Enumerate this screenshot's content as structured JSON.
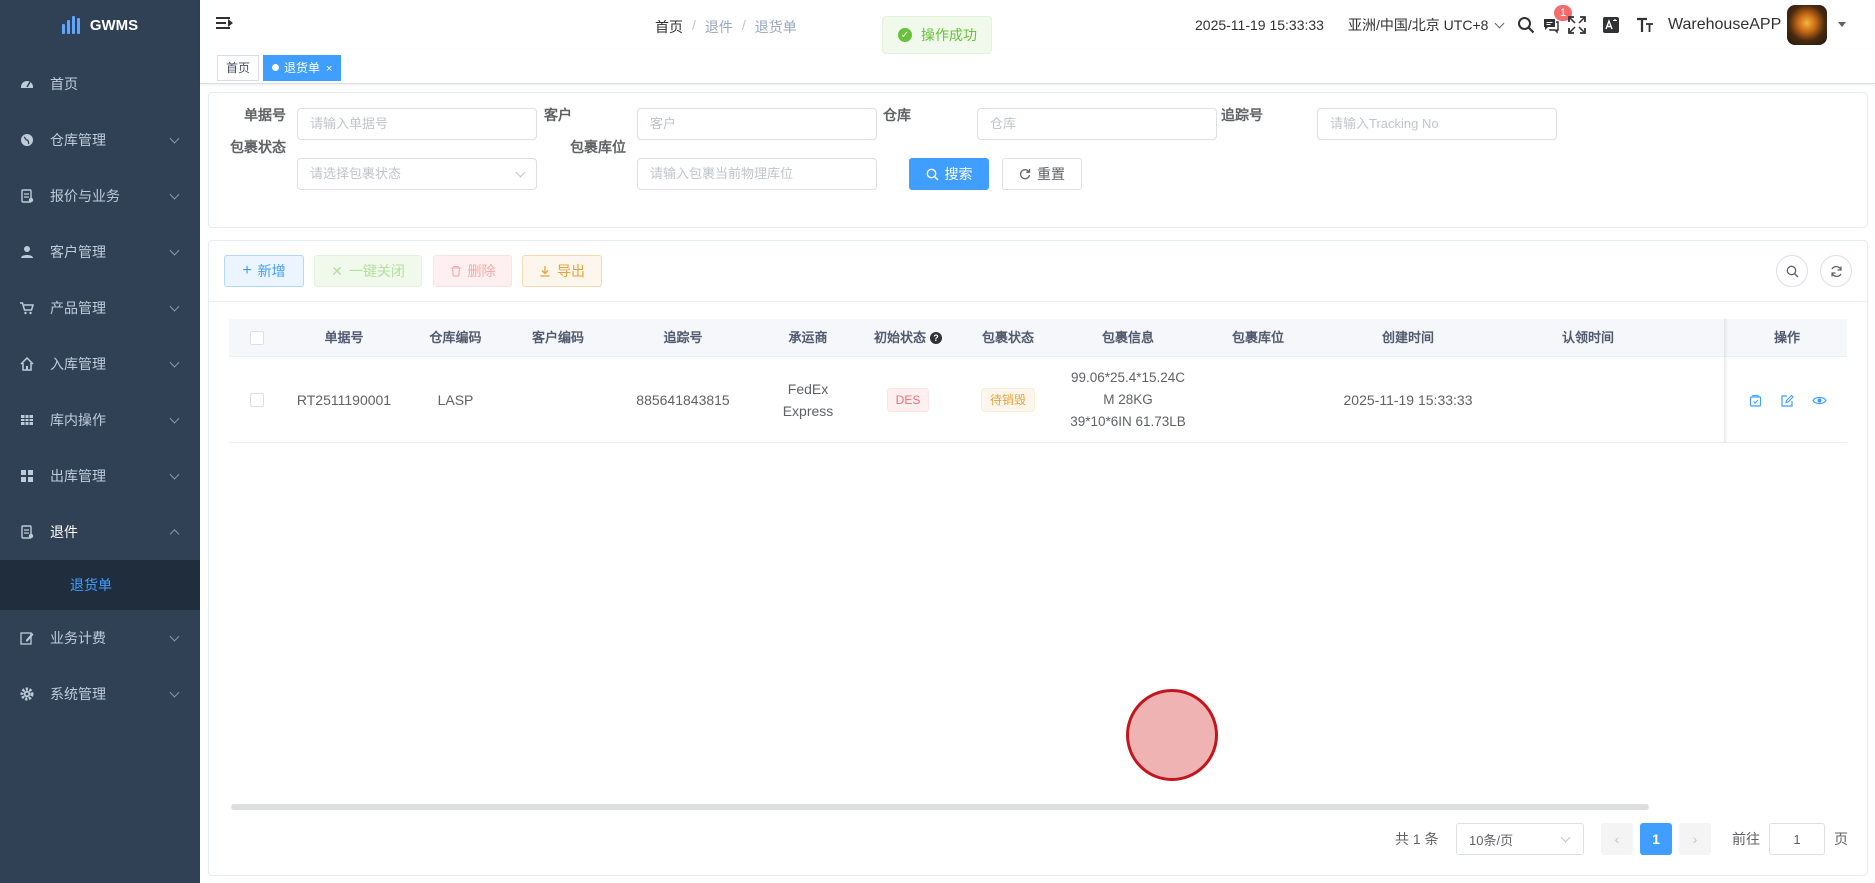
{
  "app": {
    "name": "GWMS"
  },
  "sidebar": {
    "items": [
      {
        "label": "首页",
        "icon": "dashboard-icon"
      },
      {
        "label": "仓库管理",
        "icon": "globe-icon"
      },
      {
        "label": "报价与业务",
        "icon": "quote-icon"
      },
      {
        "label": "客户管理",
        "icon": "user-icon"
      },
      {
        "label": "产品管理",
        "icon": "cart-icon"
      },
      {
        "label": "入库管理",
        "icon": "home-icon"
      },
      {
        "label": "库内操作",
        "icon": "table-icon"
      },
      {
        "label": "出库管理",
        "icon": "grid-icon"
      },
      {
        "label": "退件",
        "icon": "form-icon"
      },
      {
        "label": "业务计费",
        "icon": "edit-icon"
      },
      {
        "label": "系统管理",
        "icon": "gear-icon"
      }
    ],
    "active_sub": "退货单"
  },
  "navbar": {
    "breadcrumb": [
      "首页",
      "退件",
      "退货单"
    ],
    "toast": "操作成功",
    "datetime": "2025-11-19 15:33:33",
    "timezone": "亚洲/中国/北京 UTC+8",
    "message_count": "1",
    "username": "WarehouseAPP"
  },
  "tags": {
    "home": "首页",
    "current": "退货单"
  },
  "search": {
    "order_no_label": "单据号",
    "order_no_placeholder": "请输入单据号",
    "customer_label": "客户",
    "customer_placeholder": "客户",
    "warehouse_label": "仓库",
    "warehouse_placeholder": "仓库",
    "tracking_label": "追踪号",
    "tracking_placeholder": "请输入Tracking No",
    "pkg_status_label": "包裹状态",
    "pkg_status_placeholder": "请选择包裹状态",
    "pkg_location_label": "包裹库位",
    "pkg_location_placeholder": "请输入包裹当前物理库位",
    "search_button": "搜索",
    "reset_button": "重置"
  },
  "toolbar": {
    "add": "新增",
    "close_all": "一键关闭",
    "delete": "删除",
    "export": "导出"
  },
  "table": {
    "columns": [
      "单据号",
      "仓库编码",
      "客户编码",
      "追踪号",
      "承运商",
      "初始状态",
      "包裹状态",
      "包裹信息",
      "包裹库位",
      "创建时间",
      "认领时间",
      "操作"
    ],
    "rows": [
      {
        "order_no": "RT2511190001",
        "warehouse_code": "LASP",
        "customer_code": "",
        "tracking_no": "885641843815",
        "carrier_line1": "FedEx",
        "carrier_line2": "Express",
        "initial_status": "DES",
        "pkg_status": "待销毁",
        "pkg_info_1": "99.06*25.4*15.24C",
        "pkg_info_2": "M 28KG",
        "pkg_info_3": "39*10*6IN 61.73LB",
        "pkg_location": "",
        "created_at": "2025-11-19 15:33:33",
        "claimed_at": ""
      }
    ]
  },
  "pagination": {
    "total_text": "共 1 条",
    "page_size": "10条/页",
    "current_page": "1",
    "goto_label": "前往",
    "goto_value": "1",
    "page_suffix": "页"
  },
  "colors": {
    "sidebar_bg": "#304156",
    "primary": "#409eff",
    "success": "#67c23a",
    "danger": "#f56c6c",
    "warning": "#e6a23c"
  }
}
